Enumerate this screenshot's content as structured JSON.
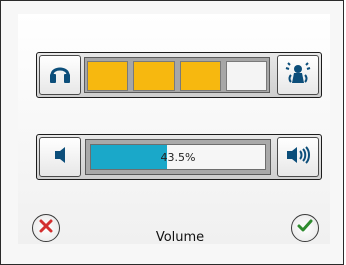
{
  "dialog": {
    "title": "Volume"
  },
  "mode": {
    "segments": [
      {
        "state": "active"
      },
      {
        "state": "active"
      },
      {
        "state": "active"
      },
      {
        "state": "inactive"
      }
    ],
    "active_color": "#f7b80f",
    "inactive_color": "#f4f4f4",
    "left_icon": "headphones-icon",
    "right_icon": "speaker-person-icon"
  },
  "volume": {
    "value_text": "43.5%",
    "value_fraction": 0.435,
    "fill_color": "#1aa8c9",
    "left_icon": "speaker-low-icon",
    "right_icon": "speaker-high-icon"
  },
  "footer": {
    "cancel_icon": "close-icon",
    "ok_icon": "check-icon",
    "cancel_color": "#d32f2f",
    "ok_color": "#2e8b2e"
  }
}
